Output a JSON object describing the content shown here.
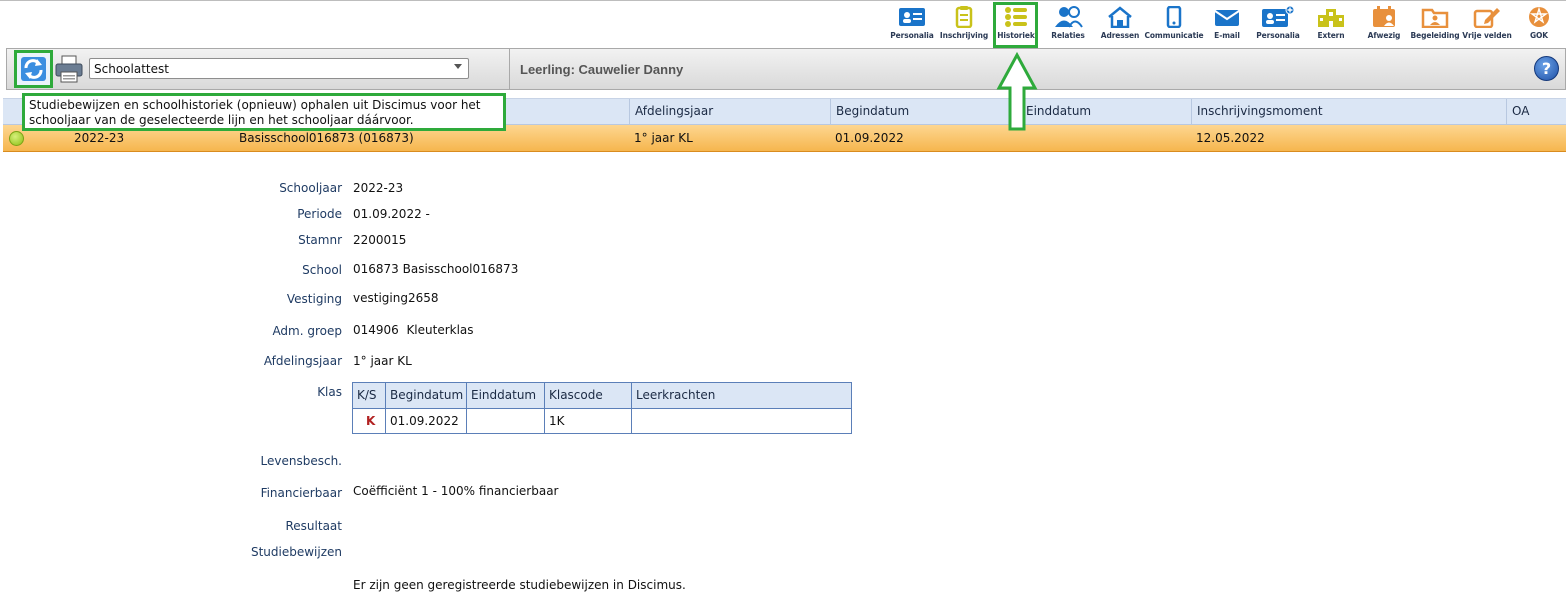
{
  "nav": [
    {
      "label": "Personalia",
      "icon": "id-card-icon",
      "color": "#1a74c9"
    },
    {
      "label": "Inschrijving",
      "icon": "clipboard-icon",
      "color": "#c9c21a"
    },
    {
      "label": "Historiek",
      "icon": "list-icon",
      "color": "#c9c21a"
    },
    {
      "label": "Relaties",
      "icon": "people-icon",
      "color": "#1a74c9"
    },
    {
      "label": "Adressen",
      "icon": "home-icon",
      "color": "#1a74c9"
    },
    {
      "label": "Communicatie",
      "icon": "phone-icon",
      "color": "#1a74c9"
    },
    {
      "label": "E-mail",
      "icon": "mail-icon",
      "color": "#1a74c9"
    },
    {
      "label": "Personalia",
      "icon": "id-card-plus-icon",
      "color": "#1a74c9"
    },
    {
      "label": "Extern",
      "icon": "school-building-icon",
      "color": "#c9c21a"
    },
    {
      "label": "Afwezig",
      "icon": "calendar-person-icon",
      "color": "#e8903c"
    },
    {
      "label": "Begeleiding",
      "icon": "folder-person-icon",
      "color": "#e8903c"
    },
    {
      "label": "Vrije velden",
      "icon": "edit-icon",
      "color": "#e8903c"
    },
    {
      "label": "GOK",
      "icon": "gok-badge-icon",
      "color": "#e8903c"
    }
  ],
  "toolbar": {
    "select_value": "Schoolattest",
    "student": "Leerling: Cauwelier Danny",
    "help": "?"
  },
  "tooltip": "Studiebewijzen en schoolhistoriek (opnieuw) ophalen uit Discimus voor het schooljaar van de geselecteerde lijn en het schooljaar dáárvoor.",
  "grid": {
    "headers": [
      "Afdelingsjaar",
      "Begindatum",
      "Einddatum",
      "Inschrijvingsmoment",
      "OA"
    ],
    "row": {
      "schooljaar": "2022-23",
      "school": "Basisschool016873 (016873)",
      "afdelingsjaar": "1° jaar KL",
      "begindatum": "01.09.2022",
      "einddatum": "",
      "inschrijvingsmoment": "12.05.2022",
      "oa": ""
    }
  },
  "details": {
    "schooljaar_label": "Schooljaar",
    "schooljaar": "2022-23",
    "periode_label": "Periode",
    "periode": "01.09.2022 -",
    "stamnr_label": "Stamnr",
    "stamnr": "2200015",
    "school_label": "School",
    "school": "016873 Basisschool016873",
    "vestiging_label": "Vestiging",
    "vestiging": "vestiging2658",
    "admgroep_label": "Adm. groep",
    "admgroep": "014906  Kleuterklas",
    "afdelingsjaar_label": "Afdelingsjaar",
    "afdelingsjaar": "1° jaar KL",
    "klas_label": "Klas",
    "levensbesch_label": "Levensbesch.",
    "financierbaar_label": "Financierbaar",
    "financierbaar": "Coëfficiënt 1 - 100% financierbaar",
    "resultaat_label": "Resultaat",
    "studiebewijzen_label": "Studiebewijzen",
    "studiebewijzen_note": "Er zijn geen geregistreerde studiebewijzen in Discimus."
  },
  "klas_table": {
    "headers": [
      "K/S",
      "Begindatum",
      "Einddatum",
      "Klascode",
      "Leerkrachten"
    ],
    "row": {
      "ks": "K",
      "begindatum": "01.09.2022",
      "einddatum": "",
      "klascode": "1K",
      "leerkrachten": ""
    }
  }
}
